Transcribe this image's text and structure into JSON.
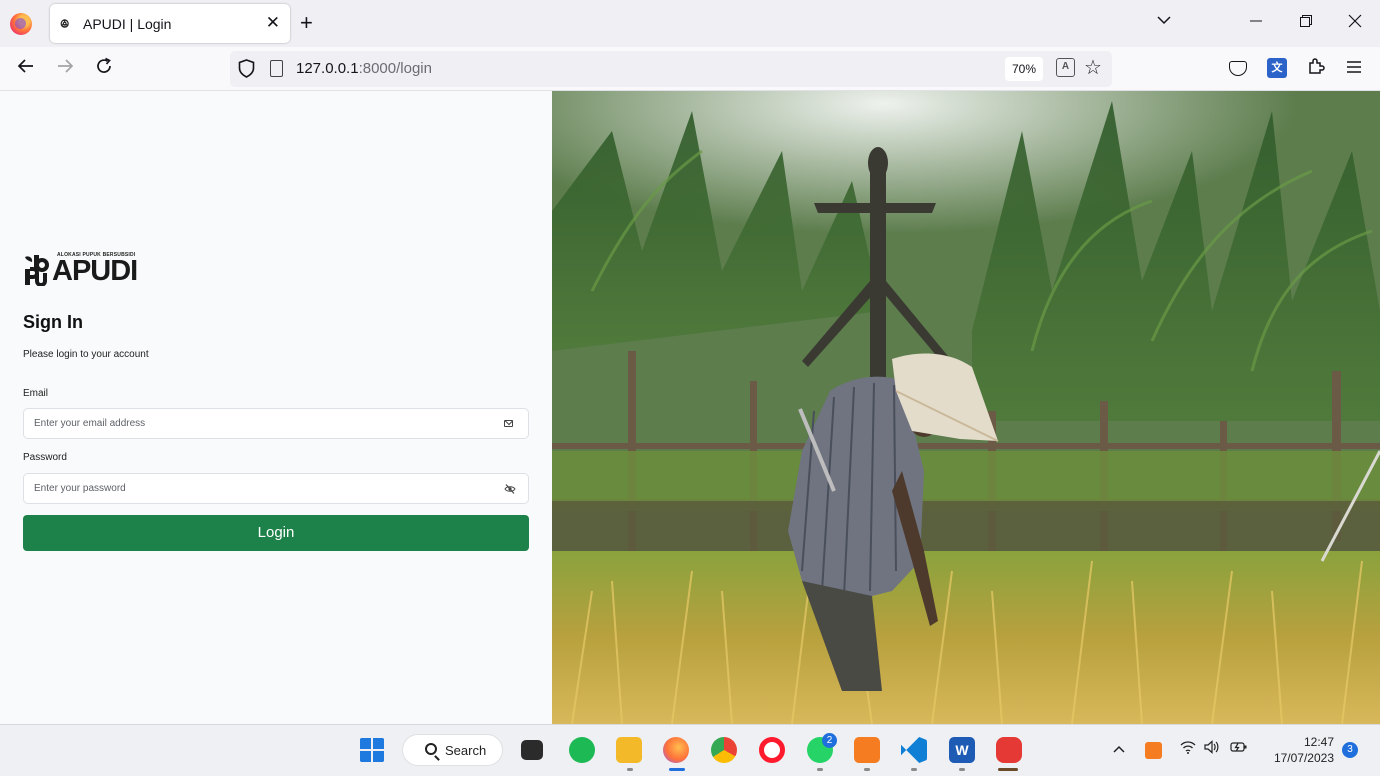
{
  "browser": {
    "tab_title": "APUDI | Login",
    "url_host": "127.0.0.1",
    "url_rest": ":8000/login",
    "zoom": "70%"
  },
  "login": {
    "logo_wordmark": "APUDI",
    "logo_tagline": "ALOKASI PUPUK BERSUBSIDI",
    "title": "Sign In",
    "subtitle": "Please login to your account",
    "email_label": "Email",
    "email_placeholder": "Enter your email address",
    "password_label": "Password",
    "password_placeholder": "Enter your password",
    "login_button": "Login"
  },
  "taskbar": {
    "search_label": "Search",
    "whatsapp_badge": "2",
    "notification_count": "3",
    "time": "12:47",
    "date": "17/07/2023"
  },
  "colors": {
    "primary_button": "#1c8249",
    "left_pane_bg": "#f9fafb",
    "brand_accent": "#d62828"
  },
  "hero_image": "farmer in conical hat working in rice field with scarecrow"
}
